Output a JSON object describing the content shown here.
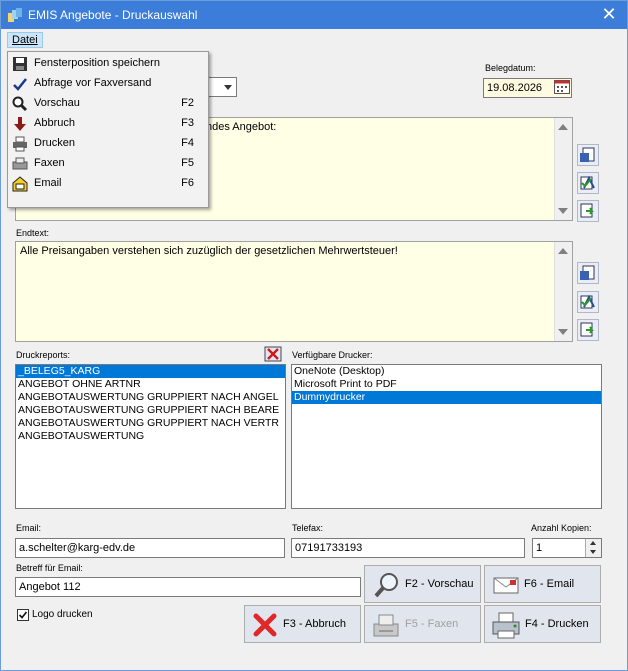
{
  "window": {
    "title": "EMIS Angebote - Druckauswahl"
  },
  "menubar": {
    "datei": "Datei"
  },
  "menu": {
    "items": [
      {
        "label": "Fensterposition speichern",
        "shortcut": "",
        "icon": "save-icon"
      },
      {
        "label": "Abfrage vor Faxversand",
        "shortcut": "",
        "icon": "check-icon"
      },
      {
        "label": "Vorschau",
        "shortcut": "F2",
        "icon": "magnifier-icon"
      },
      {
        "label": "Abbruch",
        "shortcut": "F3",
        "icon": "down-arrow-icon"
      },
      {
        "label": "Drucken",
        "shortcut": "F4",
        "icon": "printer-icon"
      },
      {
        "label": "Faxen",
        "shortcut": "F5",
        "icon": "fax-icon"
      },
      {
        "label": "Email",
        "shortcut": "F6",
        "icon": "email-icon"
      }
    ]
  },
  "belegdatum": {
    "label": "Belegdatum:",
    "value": "19.08.2026"
  },
  "anfangstext": {
    "visible_text": "ndes Angebot:"
  },
  "endtext": {
    "label": "Endtext:",
    "value": "Alle Preisangaben verstehen sich zuzüglich der gesetzlichen Mehrwertsteuer!"
  },
  "druckreports": {
    "label": "Druckreports:",
    "items": [
      "_BELEG5_KARG",
      "ANGEBOT OHNE ARTNR",
      "ANGEBOTAUSWERTUNG GRUPPIERT NACH ANGEL",
      "ANGEBOTAUSWERTUNG GRUPPIERT NACH BEARE",
      "ANGEBOTAUSWERTUNG GRUPPIERT NACH VERTR",
      "ANGEBOTAUSWERTUNG"
    ],
    "selected_index": 0
  },
  "drucker": {
    "label": "Verfügbare Drucker:",
    "items": [
      "OneNote (Desktop)",
      "Microsoft Print to PDF",
      "Dummydrucker"
    ],
    "selected_index": 2
  },
  "email": {
    "label": "Email:",
    "value": "a.schelter@karg-edv.de"
  },
  "telefax": {
    "label": "Telefax:",
    "value": "07191733193"
  },
  "kopien": {
    "label": "Anzahl Kopien:",
    "value": "1"
  },
  "betreff": {
    "label": "Betreff für Email:",
    "value": "Angebot 112"
  },
  "logo": {
    "label": "Logo drucken",
    "checked": true
  },
  "buttons": {
    "vorschau": "F2 - Vorschau",
    "email": "F6 - Email",
    "abbruch": "F3 - Abbruch",
    "faxen": "F5 - Faxen",
    "drucken": "F4 - Drucken"
  },
  "colors": {
    "titlebar": "#3b7dd8",
    "memo_bg": "#ffffe6",
    "selection": "#0078d7"
  }
}
